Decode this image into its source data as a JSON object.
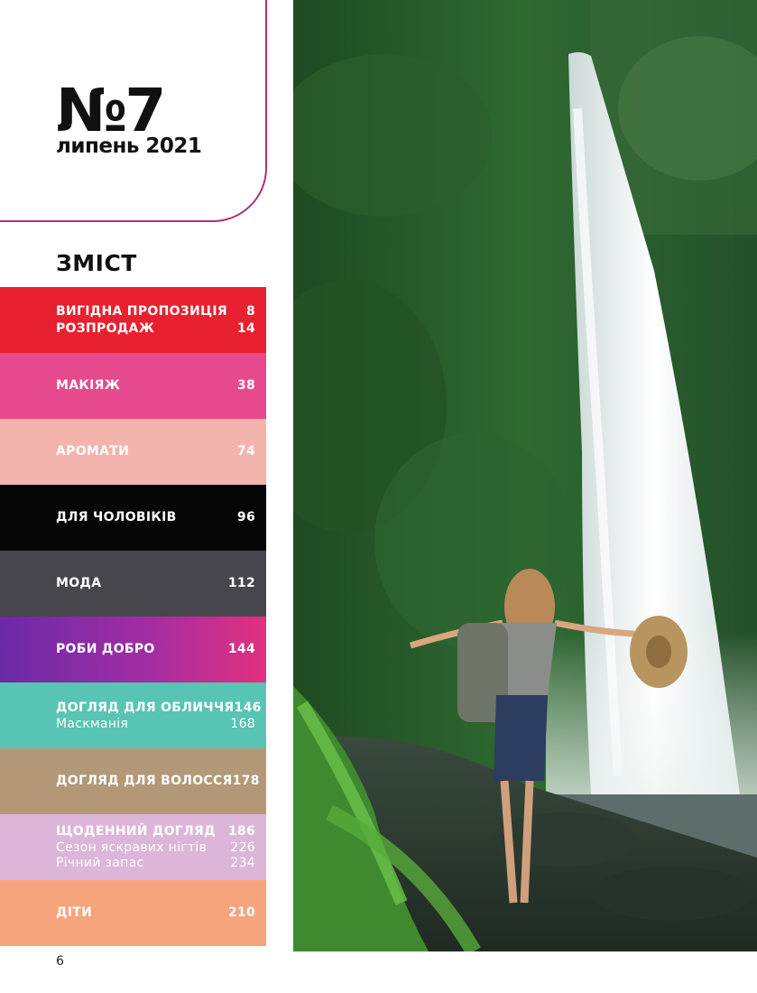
{
  "issue": {
    "number": "№7",
    "date": "липень 2021"
  },
  "toc": {
    "title": "ЗМІСТ",
    "sections": [
      {
        "color": "#e8202f",
        "entries": [
          {
            "label": "ВИГІДНА ПРОПОЗИЦІЯ",
            "page": "8",
            "style": "main"
          },
          {
            "label": "РОЗПРОДАЖ",
            "page": "14",
            "style": "main"
          }
        ]
      },
      {
        "color": "#e6498c",
        "entries": [
          {
            "label": "МАКІЯЖ",
            "page": "38",
            "style": "main"
          }
        ]
      },
      {
        "color": "#f4b4ae",
        "entries": [
          {
            "label": "АРОМАТИ",
            "page": "74",
            "style": "main"
          }
        ]
      },
      {
        "color": "#060606",
        "entries": [
          {
            "label": "ДЛЯ ЧОЛОВІКІВ",
            "page": "96",
            "style": "main"
          }
        ]
      },
      {
        "color": "#47464d",
        "entries": [
          {
            "label": "МОДА",
            "page": "112",
            "style": "main"
          }
        ]
      },
      {
        "color": "#a42da0",
        "entries": [
          {
            "label": "РОБИ ДОБРО",
            "page": "144",
            "style": "main"
          }
        ]
      },
      {
        "color": "#58c4b4",
        "entries": [
          {
            "label": "ДОГЛЯД ДЛЯ ОБЛИЧЧЯ",
            "page": "146",
            "style": "main"
          },
          {
            "label": "Маскманія",
            "page": "168",
            "style": "sub"
          }
        ]
      },
      {
        "color": "#b29877",
        "entries": [
          {
            "label": "ДОГЛЯД ДЛЯ ВОЛОССЯ",
            "page": "178",
            "style": "main"
          }
        ]
      },
      {
        "color": "#dcb6d9",
        "entries": [
          {
            "label": "ЩОДЕННИЙ ДОГЛЯД",
            "page": "186",
            "style": "main"
          },
          {
            "label": "Сезон яскравих нігтів",
            "page": "226",
            "style": "sub"
          },
          {
            "label": "Річний запас",
            "page": "234",
            "style": "sub"
          }
        ]
      },
      {
        "color": "#f6a47c",
        "entries": [
          {
            "label": "ДІТИ",
            "page": "210",
            "style": "main"
          }
        ]
      }
    ]
  },
  "footer": {
    "page_number": "6"
  },
  "colors": {
    "accent_border": "#b0306e",
    "text": "#111111"
  }
}
